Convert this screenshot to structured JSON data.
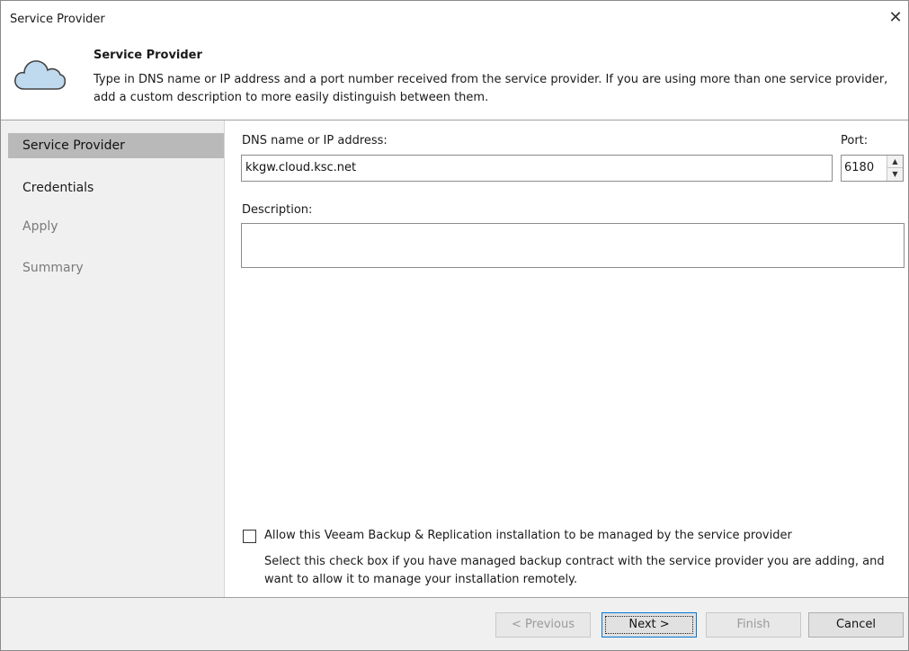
{
  "window": {
    "title": "Service Provider",
    "close_glyph": "✕"
  },
  "header": {
    "title": "Service Provider",
    "description": "Type in DNS name or IP address and a port number received from the service provider. If you are using more than one service provider, add a custom description to more easily distinguish between them.",
    "icon": "cloud-icon"
  },
  "sidebar": {
    "items": [
      {
        "label": "Service Provider",
        "state": "active"
      },
      {
        "label": "Credentials",
        "state": "enabled"
      },
      {
        "label": "Apply",
        "state": "disabled"
      },
      {
        "label": "Summary",
        "state": "disabled"
      }
    ]
  },
  "form": {
    "dns_label": "DNS name or IP address:",
    "dns_value": "kkgw.cloud.ksc.net",
    "port_label": "Port:",
    "port_value": "6180",
    "description_label": "Description:",
    "description_value": "",
    "manage_checkbox_label": "Allow this Veeam Backup & Replication installation to be managed by the service provider",
    "manage_checkbox_checked": false,
    "manage_hint": "Select this check box if you have managed backup contract with the service provider you are adding, and want to allow it to manage your installation remotely."
  },
  "footer": {
    "previous_label": "< Previous",
    "next_label": "Next >",
    "finish_label": "Finish",
    "cancel_label": "Cancel"
  },
  "colors": {
    "sidebar_bg": "#f0f0f0",
    "sidebar_active_bg": "#b9b9b9",
    "cloud_fill": "#bfd9ef",
    "default_button_border": "#0078d7"
  }
}
